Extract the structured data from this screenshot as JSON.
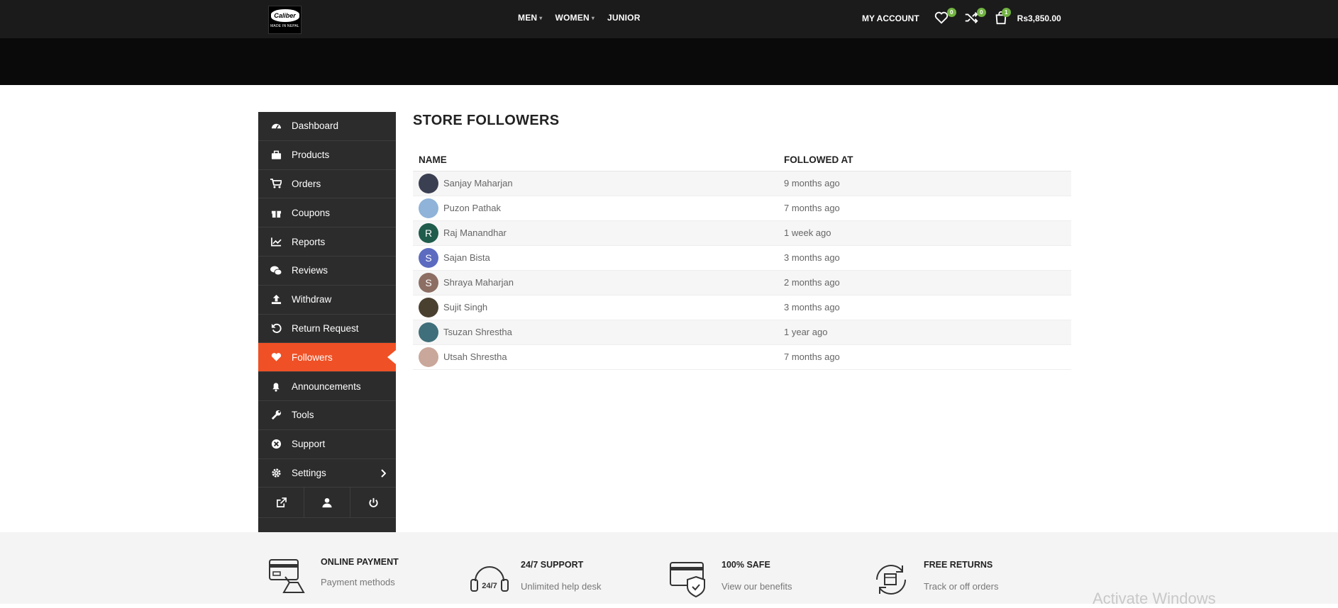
{
  "header": {
    "logo": {
      "brand": "Caliber",
      "tagline": "MADE IN NEPAL"
    },
    "nav": [
      {
        "label": "MEN",
        "dropdown": true
      },
      {
        "label": "WOMEN",
        "dropdown": true
      },
      {
        "label": "JUNIOR",
        "dropdown": false
      }
    ],
    "my_account": "MY ACCOUNT",
    "wishlist_count": "0",
    "compare_count": "0",
    "cart_count": "1",
    "cart_total": "Rs3,850.00"
  },
  "sidebar": {
    "items": [
      {
        "label": "Dashboard",
        "icon": "dashboard-icon"
      },
      {
        "label": "Products",
        "icon": "briefcase-icon"
      },
      {
        "label": "Orders",
        "icon": "cart-icon"
      },
      {
        "label": "Coupons",
        "icon": "gift-icon"
      },
      {
        "label": "Reports",
        "icon": "chart-icon"
      },
      {
        "label": "Reviews",
        "icon": "comments-icon"
      },
      {
        "label": "Withdraw",
        "icon": "upload-icon"
      },
      {
        "label": "Return Request",
        "icon": "undo-icon"
      },
      {
        "label": "Followers",
        "icon": "heart-icon",
        "active": true
      },
      {
        "label": "Announcements",
        "icon": "bell-icon"
      },
      {
        "label": "Tools",
        "icon": "wrench-icon"
      },
      {
        "label": "Support",
        "icon": "support-icon"
      },
      {
        "label": "Settings",
        "icon": "gear-icon",
        "has_submenu": true
      }
    ],
    "footer_buttons": [
      "external-link-icon",
      "user-icon",
      "power-icon"
    ],
    "active_color": "#f05025"
  },
  "page": {
    "title": "STORE FOLLOWERS",
    "columns": [
      "NAME",
      "FOLLOWED AT"
    ],
    "followers": [
      {
        "name": "Sanjay Maharjan",
        "followed": "9 months ago",
        "avatar_letter": "",
        "avatar_color": "#3b3f52"
      },
      {
        "name": "Puzon Pathak",
        "followed": "7 months ago",
        "avatar_letter": "",
        "avatar_color": "#8fb3d9"
      },
      {
        "name": "Raj Manandhar",
        "followed": "1 week ago",
        "avatar_letter": "R",
        "avatar_color": "#1f5c4c"
      },
      {
        "name": "Sajan Bista",
        "followed": "3 months ago",
        "avatar_letter": "S",
        "avatar_color": "#5c6bc0"
      },
      {
        "name": "Shraya Maharjan",
        "followed": "2 months ago",
        "avatar_letter": "S",
        "avatar_color": "#8d6e63"
      },
      {
        "name": "Sujit Singh",
        "followed": "3 months ago",
        "avatar_letter": "",
        "avatar_color": "#4a4030"
      },
      {
        "name": "Tsuzan Shrestha",
        "followed": "1 year ago",
        "avatar_letter": "",
        "avatar_color": "#3f6f7a"
      },
      {
        "name": "Utsah Shrestha",
        "followed": "7 months ago",
        "avatar_letter": "",
        "avatar_color": "#c9a79a"
      }
    ]
  },
  "footer": {
    "features": [
      {
        "title": "ONLINE PAYMENT",
        "subtitle": "Payment methods",
        "icon": "credit-card-hand-icon"
      },
      {
        "title": "24/7 SUPPORT",
        "subtitle": "Unlimited help desk",
        "icon": "headset-icon"
      },
      {
        "title": "100% SAFE",
        "subtitle": "View our benefits",
        "icon": "shield-card-icon"
      },
      {
        "title": "FREE RETURNS",
        "subtitle": "Track or off orders",
        "icon": "return-box-icon"
      }
    ]
  },
  "watermark": "Activate Windows"
}
